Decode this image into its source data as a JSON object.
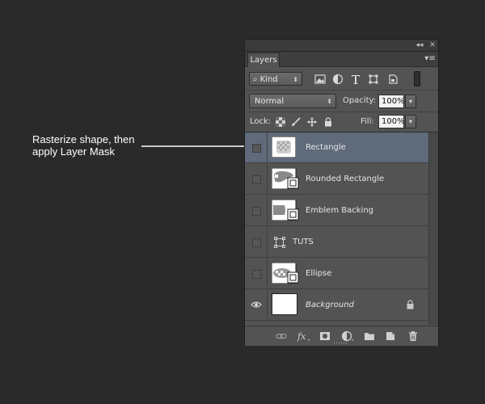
{
  "annotation": {
    "line1": "Rasterize shape, then",
    "line2": "apply Layer Mask"
  },
  "panel": {
    "tab_label": "Layers",
    "collapse_glyph": "◂◂",
    "close_glyph": "✕",
    "menu_glyph": "▾≡"
  },
  "filter": {
    "search_glyph": "⌕",
    "kind_label": "Kind",
    "icons": [
      "pixel-filter-icon",
      "adjustment-filter-icon",
      "type-filter-icon",
      "shape-filter-icon",
      "smart-object-filter-icon"
    ]
  },
  "blend": {
    "mode": "Normal",
    "opacity_label": "Opacity:",
    "opacity_value": "100%",
    "fill_label": "Fill:",
    "fill_value": "100%"
  },
  "lock": {
    "label": "Lock:"
  },
  "layers": [
    {
      "name": "Rectangle",
      "selected": true,
      "visible": false,
      "thumb": "rect-raster"
    },
    {
      "name": "Rounded Rectangle",
      "selected": false,
      "visible": false,
      "thumb": "shape"
    },
    {
      "name": "Emblem Backing",
      "selected": false,
      "visible": false,
      "thumb": "shape"
    },
    {
      "name": "TUTS",
      "selected": false,
      "visible": false,
      "thumb": "text"
    },
    {
      "name": "Ellipse",
      "selected": false,
      "visible": false,
      "thumb": "shape"
    },
    {
      "name": "Background",
      "selected": false,
      "visible": true,
      "thumb": "white",
      "italic": true,
      "locked": true
    }
  ],
  "colors": {
    "background": "#2a2a2a",
    "panel": "#535353",
    "selected_row": "#5f6a7a",
    "annotation_text": "#ffffff"
  }
}
